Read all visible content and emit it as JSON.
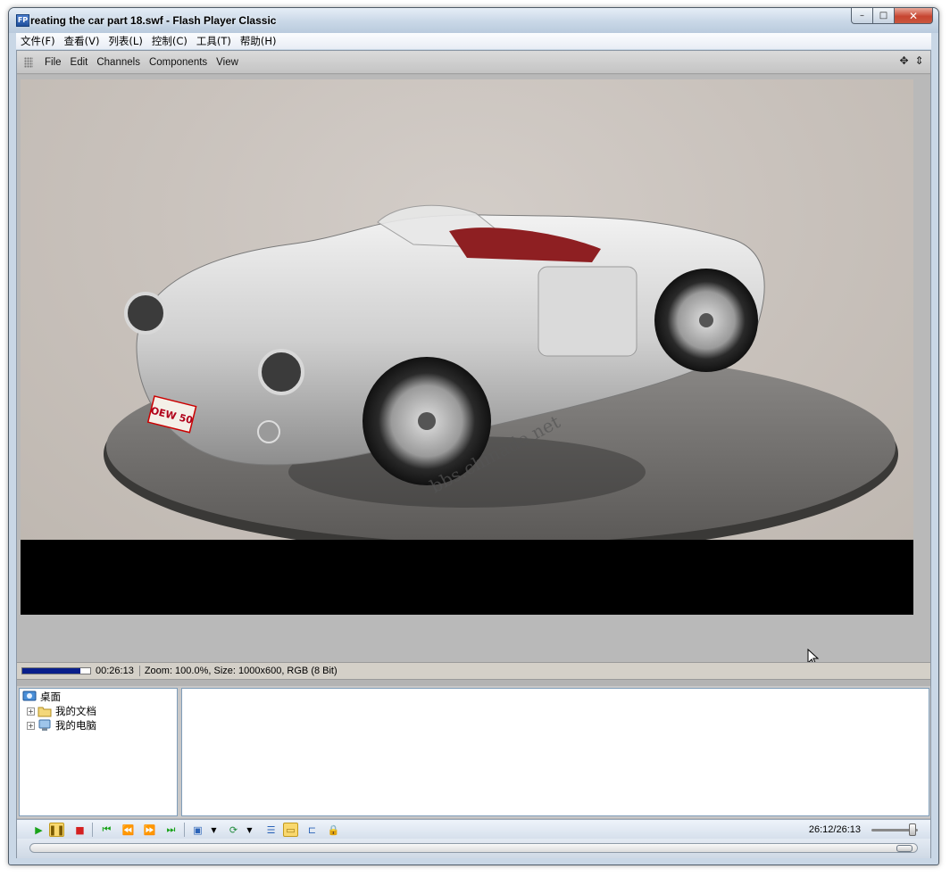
{
  "window": {
    "title": "reating the car part 18.swf - Flash Player Classic",
    "app_icon_text": "FP",
    "caption": {
      "minimize_glyph": "–",
      "maximize_glyph": "□",
      "close_glyph": "✕"
    }
  },
  "menubar": {
    "items": [
      "文件(F)",
      "查看(V)",
      "列表(L)",
      "控制(C)",
      "工具(T)",
      "帮助(H)"
    ]
  },
  "inner_toolbar": {
    "items": [
      "File",
      "Edit",
      "Channels",
      "Components",
      "View"
    ],
    "right_icons": [
      "move-icon",
      "pin-icon"
    ]
  },
  "stage": {
    "watermark": "bbs.chinade.net",
    "license_plate": "OEW 50"
  },
  "status": {
    "progress_fraction": 0.85,
    "time": "00:26:13",
    "info": "Zoom: 100.0%, Size: 1000x600, RGB (8 Bit)"
  },
  "tree": {
    "root": "桌面",
    "children": [
      "我的文档",
      "我的电脑"
    ]
  },
  "controls": {
    "time_readout": "26:12/26:13",
    "buttons": [
      "play-icon",
      "pause-icon",
      "stop-icon",
      "skip-start-icon",
      "rewind-icon",
      "fast-forward-icon",
      "skip-end-icon",
      "snapshot-icon",
      "repeat-icon",
      "playlist-icon",
      "folder-icon",
      "open-folder-icon",
      "lock-icon"
    ],
    "volume_fraction": 0.9
  },
  "seek": {
    "fraction": 1.0
  },
  "colors": {
    "accent_progress": "#0a1f8a",
    "title_gradient_top": "#e6eef7",
    "stage_bg": "#c8c1bb"
  }
}
